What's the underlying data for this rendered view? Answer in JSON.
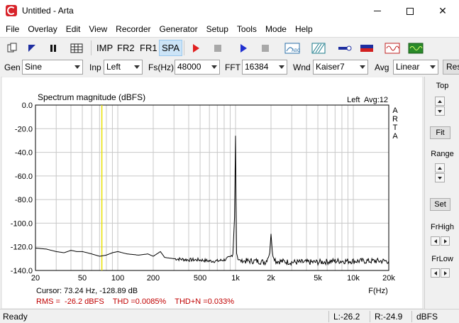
{
  "window": {
    "title": "Untitled - Arta"
  },
  "menu": [
    "File",
    "Overlay",
    "Edit",
    "View",
    "Recorder",
    "Generator",
    "Setup",
    "Tools",
    "Mode",
    "Help"
  ],
  "toolbar": {
    "imp": "IMP",
    "fr2": "FR2",
    "fr1": "FR1",
    "spa": "SPA"
  },
  "params": {
    "gen_label": "Gen",
    "gen_value": "Sine",
    "inp_label": "Inp",
    "inp_value": "Left",
    "fs_label": "Fs(Hz)",
    "fs_value": "48000",
    "fft_label": "FFT",
    "fft_value": "16384",
    "wnd_label": "Wnd",
    "wnd_value": "Kaiser7",
    "avg_label": "Avg",
    "avg_value": "Linear",
    "res_label": "Res"
  },
  "plot": {
    "title": "Spectrum magnitude (dBFS)",
    "channel_info": "Left  Avg:12",
    "arta_letters": [
      "A",
      "R",
      "T",
      "A"
    ],
    "y_ticks": [
      "0.0",
      "-20.0",
      "-40.0",
      "-60.0",
      "-80.0",
      "-100.0",
      "-120.0",
      "-140.0"
    ],
    "x_ticks": [
      "20",
      "50",
      "100",
      "200",
      "500",
      "1k",
      "2k",
      "5k",
      "10k",
      "20k"
    ],
    "x_unit": "F(Hz)",
    "cursor_text": "Cursor: 73.24 Hz, -128.89 dB",
    "metrics_text": "RMS =  -26.2 dBFS    THD =0.0085%    THD+N =0.033%",
    "cursor_color": "#e8e000",
    "trace_color": "#000000",
    "metrics_color": "#c00000"
  },
  "chart_data": {
    "type": "line",
    "title": "Spectrum magnitude (dBFS)",
    "xlabel": "F(Hz)",
    "ylabel": "",
    "xscale": "log",
    "xlim": [
      20,
      20000
    ],
    "ylim": [
      -140,
      0
    ],
    "grid": true,
    "cursor_x": 73.24,
    "series": [
      {
        "x": [
          20,
          25,
          30,
          35,
          40,
          45,
          50,
          55,
          60,
          70,
          80,
          90,
          100,
          120,
          150,
          180,
          200,
          230,
          250,
          300,
          400,
          500,
          600,
          700,
          800,
          900,
          950,
          980,
          1000,
          1010,
          1020,
          1050,
          1100,
          1200,
          1500,
          1800,
          1950,
          2000,
          2050,
          2200,
          3000,
          4000,
          5000,
          7000,
          10000,
          15000,
          20000
        ],
        "y": [
          -121,
          -122,
          -124,
          -125,
          -123,
          -124,
          -124,
          -125,
          -126,
          -128,
          -127,
          -125,
          -124,
          -126,
          -127,
          -126,
          -128,
          -124,
          -129,
          -130,
          -131,
          -131,
          -132,
          -132,
          -131,
          -129,
          -126,
          -95,
          -26,
          -80,
          -125,
          -130,
          -132,
          -132,
          -132,
          -133,
          -125,
          -109,
          -125,
          -132,
          -133,
          -133,
          -133,
          -132,
          -132,
          -132,
          -132
        ]
      }
    ]
  },
  "right_panel": {
    "top_label": "Top",
    "fit_label": "Fit",
    "range_label": "Range",
    "set_label": "Set",
    "frhigh_label": "FrHigh",
    "frlow_label": "FrLow"
  },
  "status": {
    "ready": "Ready",
    "left_level": "L:-26.2",
    "right_level": "R:-24.9",
    "unit": "dBFS"
  }
}
